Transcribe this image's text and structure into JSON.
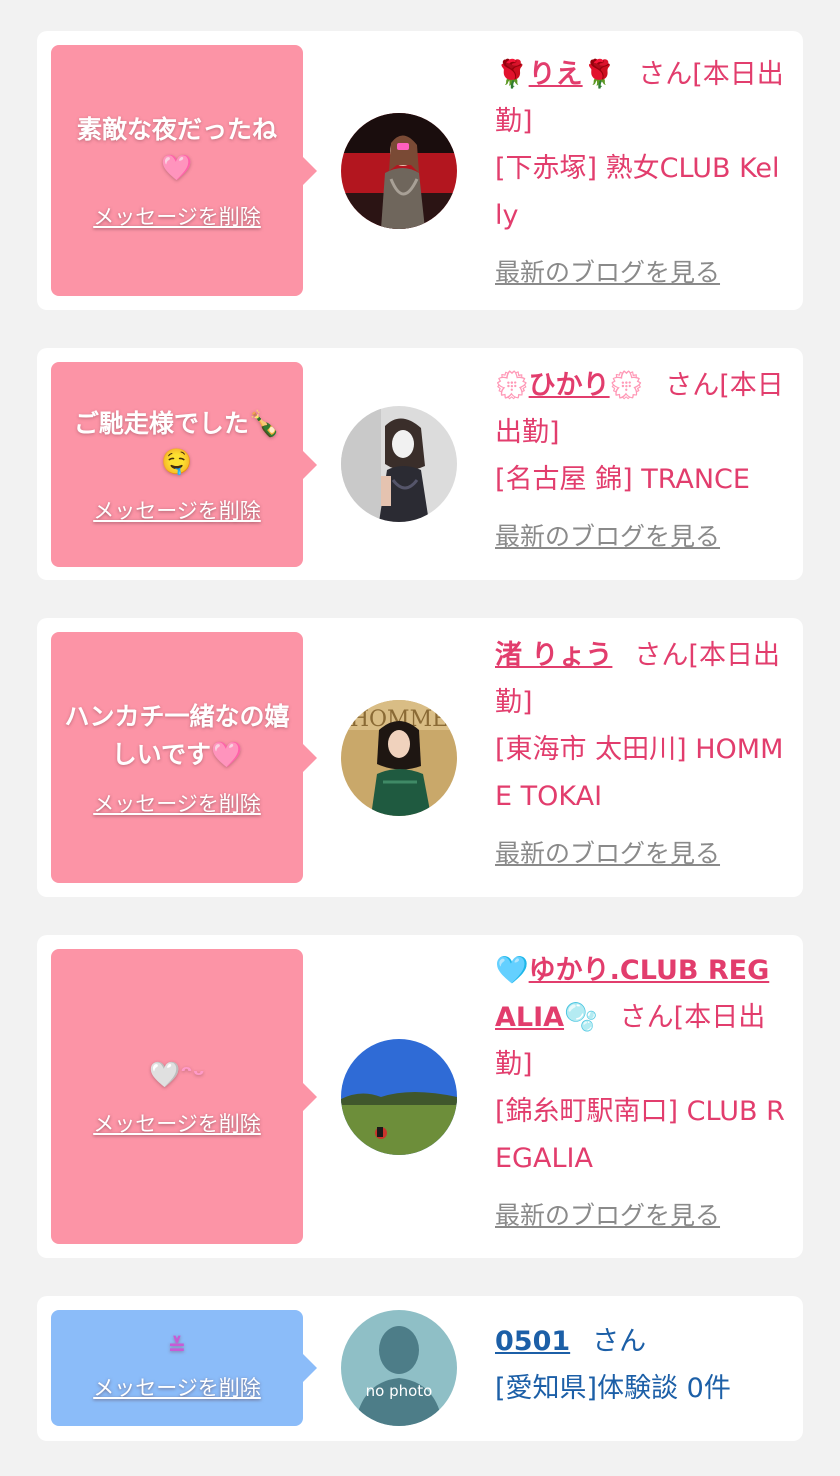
{
  "delete_label": "メッセージを削除",
  "blog_label": "最新のブログを見る",
  "suffix": "さん",
  "cards": [
    {
      "message": "素敵な夜だったね",
      "message_emoji": "🩷",
      "name_pre": "🌹",
      "name": "りえ",
      "name_post": "🌹",
      "status": "[本日出勤]",
      "shop": "[下赤塚] 熟女CLUB Kelly"
    },
    {
      "message": "ご馳走様でした🍾",
      "message_emoji": "🤤",
      "name_pre": "💮",
      "name": "ひかり",
      "name_post": "💮",
      "status": "[本日出勤]",
      "shop": "[名古屋 錦] TRANCE"
    },
    {
      "message": "ハンカチ一緒なの嬉しいです",
      "message_emoji": "🩷",
      "name_pre": "",
      "name": "渚 りょう",
      "name_post": "",
      "status": "[本日出勤]",
      "shop": "[東海市 太田川] HOMME TOKAI"
    },
    {
      "message": "🤍",
      "message_emoji": "ᵔᵕ",
      "name_pre": "🩵",
      "name": "ゆかり.CLUB REGALIA",
      "name_post": "🫧",
      "status": "[本日出勤]",
      "shop": "[錦糸町駅南口] CLUB REGALIA"
    },
    {
      "message": "",
      "message_emoji": "≚",
      "name_pre": "",
      "name": "0501",
      "name_post": "",
      "status": "",
      "shop": "[愛知県]体験談 0件",
      "avatar_text": "no photo"
    }
  ]
}
